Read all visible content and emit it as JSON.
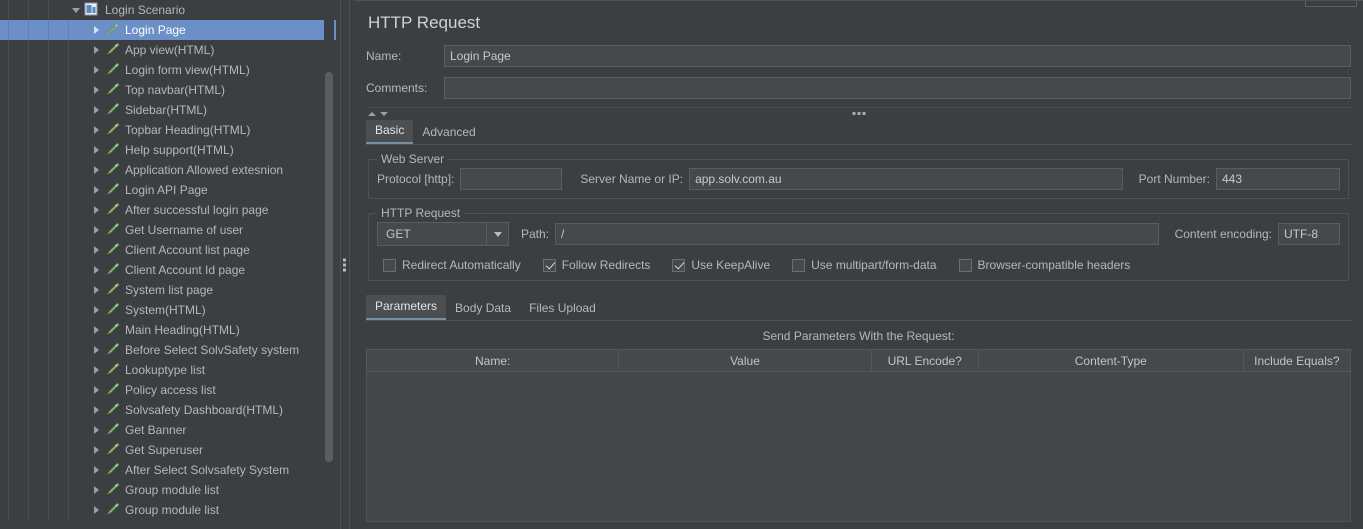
{
  "tree": {
    "scrollbar": {
      "name": "tree-vertical-scrollbar"
    },
    "nodes": [
      {
        "label": "Login Scenario",
        "depth": 4,
        "icon": "thread-group-icon",
        "expanded": true,
        "selected": false
      },
      {
        "label": "Login Page",
        "depth": 5,
        "icon": "http-sampler-icon",
        "expanded": false,
        "selected": true
      },
      {
        "label": "App view(HTML)",
        "depth": 5,
        "icon": "http-sampler-icon",
        "expanded": false,
        "selected": false
      },
      {
        "label": "Login form view(HTML)",
        "depth": 5,
        "icon": "http-sampler-icon",
        "expanded": false,
        "selected": false
      },
      {
        "label": "Top navbar(HTML)",
        "depth": 5,
        "icon": "http-sampler-icon",
        "expanded": false,
        "selected": false
      },
      {
        "label": "Sidebar(HTML)",
        "depth": 5,
        "icon": "http-sampler-icon",
        "expanded": false,
        "selected": false
      },
      {
        "label": "Topbar Heading(HTML)",
        "depth": 5,
        "icon": "http-sampler-icon",
        "expanded": false,
        "selected": false
      },
      {
        "label": "Help support(HTML)",
        "depth": 5,
        "icon": "http-sampler-icon",
        "expanded": false,
        "selected": false
      },
      {
        "label": "Application Allowed extesnion",
        "depth": 5,
        "icon": "http-sampler-icon",
        "expanded": false,
        "selected": false
      },
      {
        "label": "Login API Page",
        "depth": 5,
        "icon": "http-sampler-icon",
        "expanded": false,
        "selected": false
      },
      {
        "label": "After successful login page",
        "depth": 5,
        "icon": "http-sampler-icon",
        "expanded": false,
        "selected": false
      },
      {
        "label": "Get Username of user",
        "depth": 5,
        "icon": "http-sampler-icon",
        "expanded": false,
        "selected": false
      },
      {
        "label": "Client Account list page",
        "depth": 5,
        "icon": "http-sampler-icon",
        "expanded": false,
        "selected": false
      },
      {
        "label": "Client Account Id page",
        "depth": 5,
        "icon": "http-sampler-icon",
        "expanded": false,
        "selected": false
      },
      {
        "label": "System list page",
        "depth": 5,
        "icon": "http-sampler-icon",
        "expanded": false,
        "selected": false
      },
      {
        "label": "System(HTML)",
        "depth": 5,
        "icon": "http-sampler-icon",
        "expanded": false,
        "selected": false
      },
      {
        "label": "Main Heading(HTML)",
        "depth": 5,
        "icon": "http-sampler-icon",
        "expanded": false,
        "selected": false
      },
      {
        "label": "Before Select SolvSafety system",
        "depth": 5,
        "icon": "http-sampler-icon",
        "expanded": false,
        "selected": false
      },
      {
        "label": "Lookuptype list",
        "depth": 5,
        "icon": "http-sampler-icon",
        "expanded": false,
        "selected": false
      },
      {
        "label": "Policy access list",
        "depth": 5,
        "icon": "http-sampler-icon",
        "expanded": false,
        "selected": false
      },
      {
        "label": "Solvsafety Dashboard(HTML)",
        "depth": 5,
        "icon": "http-sampler-icon",
        "expanded": false,
        "selected": false
      },
      {
        "label": "Get Banner",
        "depth": 5,
        "icon": "http-sampler-icon",
        "expanded": false,
        "selected": false
      },
      {
        "label": "Get Superuser",
        "depth": 5,
        "icon": "http-sampler-icon",
        "expanded": false,
        "selected": false
      },
      {
        "label": "After Select Solvsafety System",
        "depth": 5,
        "icon": "http-sampler-icon",
        "expanded": false,
        "selected": false
      },
      {
        "label": "Group module list",
        "depth": 5,
        "icon": "http-sampler-icon",
        "expanded": false,
        "selected": false
      },
      {
        "label": "Group module list",
        "depth": 5,
        "icon": "http-sampler-icon",
        "expanded": false,
        "selected": false
      }
    ]
  },
  "panel": {
    "title": "HTTP Request",
    "name_label": "Name:",
    "name_value": "Login Page",
    "comments_label": "Comments:",
    "comments_value": "",
    "tabs": [
      {
        "label": "Basic",
        "active": true
      },
      {
        "label": "Advanced",
        "active": false
      }
    ],
    "web_server": {
      "legend": "Web Server",
      "protocol_label": "Protocol [http]:",
      "protocol_value": "",
      "server_label": "Server Name or IP:",
      "server_value": "app.solv.com.au",
      "port_label": "Port Number:",
      "port_value": "443"
    },
    "http_request": {
      "legend": "HTTP Request",
      "method_value": "GET",
      "path_label": "Path:",
      "path_value": "/",
      "encoding_label": "Content encoding:",
      "encoding_value": "UTF-8",
      "checkboxes": [
        {
          "label": "Redirect Automatically",
          "checked": false
        },
        {
          "label": "Follow Redirects",
          "checked": true
        },
        {
          "label": "Use KeepAlive",
          "checked": true
        },
        {
          "label": "Use multipart/form-data",
          "checked": false
        },
        {
          "label": "Browser-compatible headers",
          "checked": false
        }
      ]
    },
    "sub_tabs": [
      {
        "label": "Parameters",
        "active": true
      },
      {
        "label": "Body Data",
        "active": false
      },
      {
        "label": "Files Upload",
        "active": false
      }
    ],
    "params_table": {
      "caption": "Send Parameters With the Request:",
      "columns": [
        "Name:",
        "Value",
        "URL Encode?",
        "Content-Type",
        "Include Equals?"
      ],
      "rows": []
    }
  },
  "colors": {
    "background": "#3c3f41",
    "selection": "#6c8fc7",
    "field_bg": "#45494a",
    "border": "#4f5254",
    "text": "#b4b8bb"
  }
}
